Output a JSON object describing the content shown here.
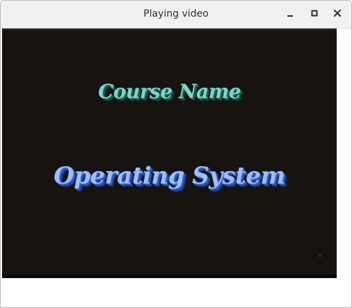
{
  "window": {
    "title": "Playing video",
    "controls": {
      "minimize_icon": "minimize-icon",
      "maximize_icon": "maximize-icon",
      "close_icon": "close-icon"
    }
  },
  "video": {
    "course_label": "Course Name",
    "course_title": "Operating System",
    "colors": {
      "background": "#161311",
      "course_label": "#7fd4c6",
      "course_title": "#9ebcf5"
    }
  }
}
